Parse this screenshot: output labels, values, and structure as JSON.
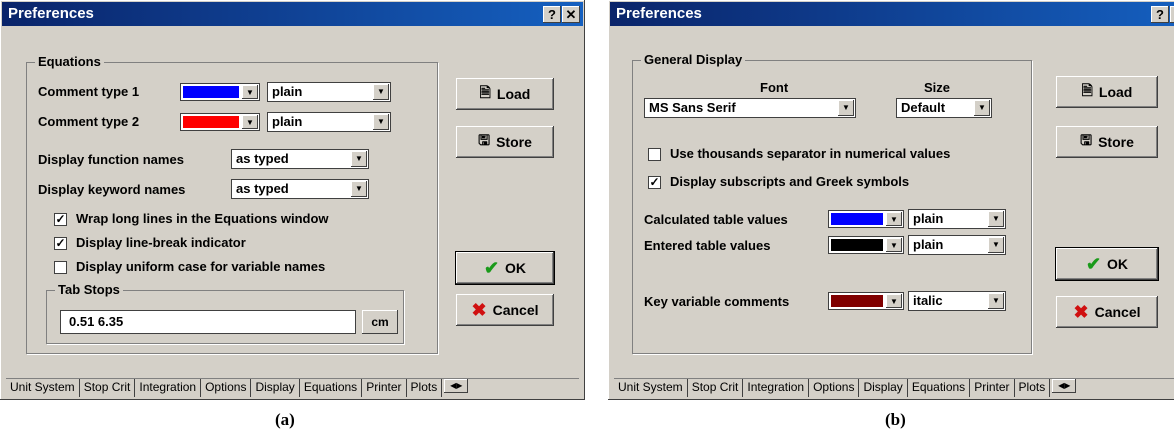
{
  "dialog_a": {
    "title": "Preferences",
    "help_btn": "?",
    "close_btn": "✕",
    "group_equations": "Equations",
    "comment_type_1": {
      "label": "Comment type 1",
      "color": "#0000ff",
      "style": "plain"
    },
    "comment_type_2": {
      "label": "Comment type 2",
      "color": "#ff0000",
      "style": "plain"
    },
    "display_function_names": {
      "label": "Display function names",
      "value": "as typed"
    },
    "display_keyword_names": {
      "label": "Display keyword names",
      "value": "as typed"
    },
    "checkboxes": [
      {
        "label": "Wrap long lines in the Equations window",
        "checked": "✓"
      },
      {
        "label": "Display line-break indicator",
        "checked": "✓"
      },
      {
        "label": "Display uniform case for variable names",
        "checked": ""
      }
    ],
    "tab_stops": {
      "legend": "Tab Stops",
      "value": "0.51 6.35",
      "unit": "cm"
    },
    "buttons": {
      "load": "Load",
      "store": "Store",
      "ok": "OK",
      "cancel": "Cancel"
    },
    "tabs": [
      "Unit System",
      "Stop Crit",
      "Integration",
      "Options",
      "Display",
      "Equations",
      "Printer",
      "Plots"
    ],
    "active_tab": "Equations",
    "caption": "(a)"
  },
  "dialog_b": {
    "title": "Preferences",
    "help_btn": "?",
    "close_btn": "✕",
    "group_general": "General Display",
    "font_header": "Font",
    "size_header": "Size",
    "font_value": "MS Sans Serif",
    "size_value": "Default",
    "checkboxes": [
      {
        "label": "Use thousands separator in numerical values",
        "checked": ""
      },
      {
        "label": "Display subscripts and Greek symbols",
        "checked": "✓"
      }
    ],
    "calculated_table_values": {
      "label": "Calculated table values",
      "color": "#0000ff",
      "style": "plain"
    },
    "entered_table_values": {
      "label": "Entered table values",
      "color": "#000000",
      "style": "plain"
    },
    "key_variable_comments": {
      "label": "Key variable comments",
      "color": "#800000",
      "style": "italic"
    },
    "buttons": {
      "load": "Load",
      "store": "Store",
      "ok": "OK",
      "cancel": "Cancel"
    },
    "tabs": [
      "Unit System",
      "Stop Crit",
      "Integration",
      "Options",
      "Display",
      "Equations",
      "Printer",
      "Plots"
    ],
    "active_tab": "Display",
    "caption": "(b)"
  }
}
